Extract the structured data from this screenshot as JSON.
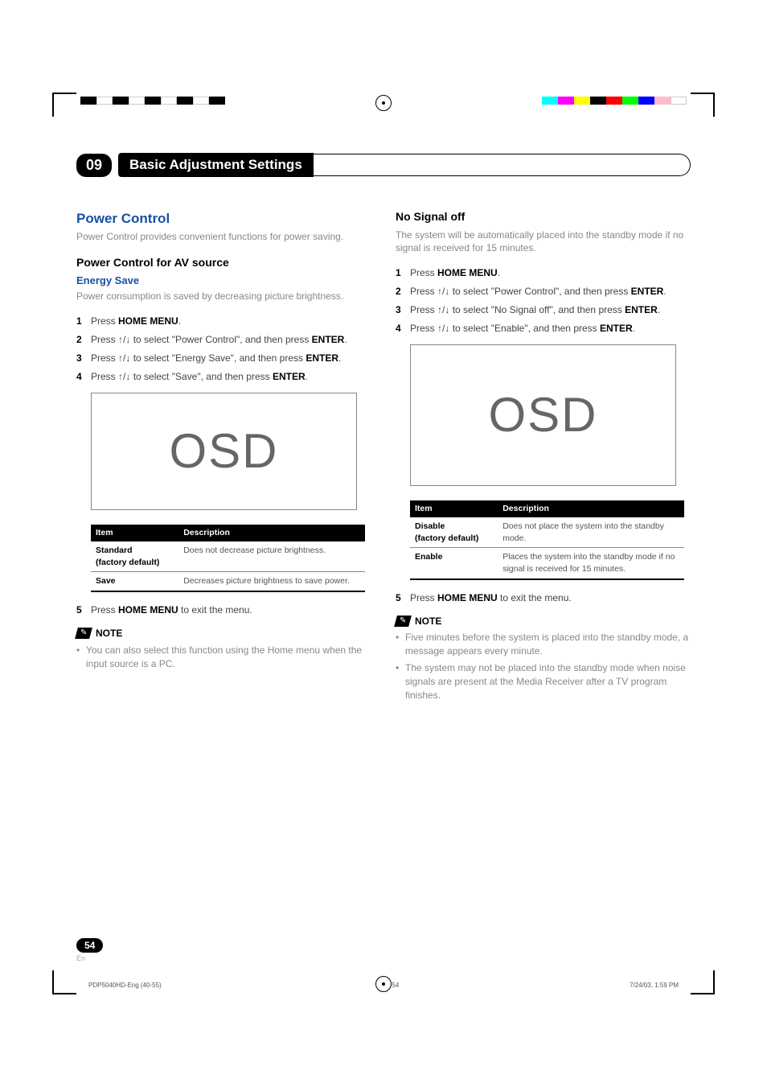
{
  "chapter": {
    "number": "09",
    "title": "Basic Adjustment Settings"
  },
  "left": {
    "h2": "Power Control",
    "intro": "Power Control provides convenient functions for power saving.",
    "h3": "Power Control for AV source",
    "h4": "Energy Save",
    "h4desc": "Power consumption is saved by decreasing picture brightness.",
    "steps": [
      {
        "n": "1",
        "pre": "Press ",
        "b": "HOME MENU",
        "post": "."
      },
      {
        "n": "2",
        "pre": "Press ",
        "arrows": "↑/↓",
        "mid": " to select \"Power Control\", and then press ",
        "b": "ENTER",
        "post": "."
      },
      {
        "n": "3",
        "pre": "Press ",
        "arrows": "↑/↓",
        "mid": " to select \"Energy Save\", and then press ",
        "b": "ENTER",
        "post": "."
      },
      {
        "n": "4",
        "pre": "Press ",
        "arrows": "↑/↓",
        "mid": " to select \"Save\", and then press ",
        "b": "ENTER",
        "post": "."
      }
    ],
    "osd": "OSD",
    "table": {
      "head": [
        "Item",
        "Description"
      ],
      "rows": [
        {
          "item": "Standard",
          "sub": "(factory default)",
          "desc": "Does not decrease picture brightness."
        },
        {
          "item": "Save",
          "sub": "",
          "desc": "Decreases picture brightness to save power."
        }
      ]
    },
    "step5": {
      "n": "5",
      "pre": "Press ",
      "b": "HOME MENU",
      "post": " to exit the menu."
    },
    "noteLabel": "NOTE",
    "notes": [
      "You can also select this function using the Home menu when the input source is a PC."
    ]
  },
  "right": {
    "h3": "No Signal off",
    "intro": "The system will be automatically placed into the standby mode if no signal is received for 15 minutes.",
    "steps": [
      {
        "n": "1",
        "pre": "Press ",
        "b": "HOME MENU",
        "post": "."
      },
      {
        "n": "2",
        "pre": "Press ",
        "arrows": "↑/↓",
        "mid": " to select \"Power Control\", and then press ",
        "b": "ENTER",
        "post": "."
      },
      {
        "n": "3",
        "pre": "Press ",
        "arrows": "↑/↓",
        "mid": " to select \"No Signal off\", and then press ",
        "b": "ENTER",
        "post": "."
      },
      {
        "n": "4",
        "pre": "Press ",
        "arrows": "↑/↓",
        "mid": " to select \"Enable\", and then press ",
        "b": "ENTER",
        "post": "."
      }
    ],
    "osd": "OSD",
    "table": {
      "head": [
        "Item",
        "Description"
      ],
      "rows": [
        {
          "item": "Disable",
          "sub": "(factory default)",
          "desc": "Does not place the system into the standby mode."
        },
        {
          "item": "Enable",
          "sub": "",
          "desc": "Places the system into the standby mode if no signal is received for 15 minutes."
        }
      ]
    },
    "step5": {
      "n": "5",
      "pre": "Press ",
      "b": "HOME MENU",
      "post": " to exit the menu."
    },
    "noteLabel": "NOTE",
    "notes": [
      "Five minutes before the system is placed into the standby mode, a message appears every minute.",
      "The system may not be placed into the standby mode when noise signals are present at the Media Receiver after a TV program finishes."
    ]
  },
  "pageNumber": "54",
  "pageLang": "En",
  "footer": {
    "left": "PDP5040HD-Eng (40-55)",
    "mid": "54",
    "right": "7/24/03, 1:59 PM"
  }
}
